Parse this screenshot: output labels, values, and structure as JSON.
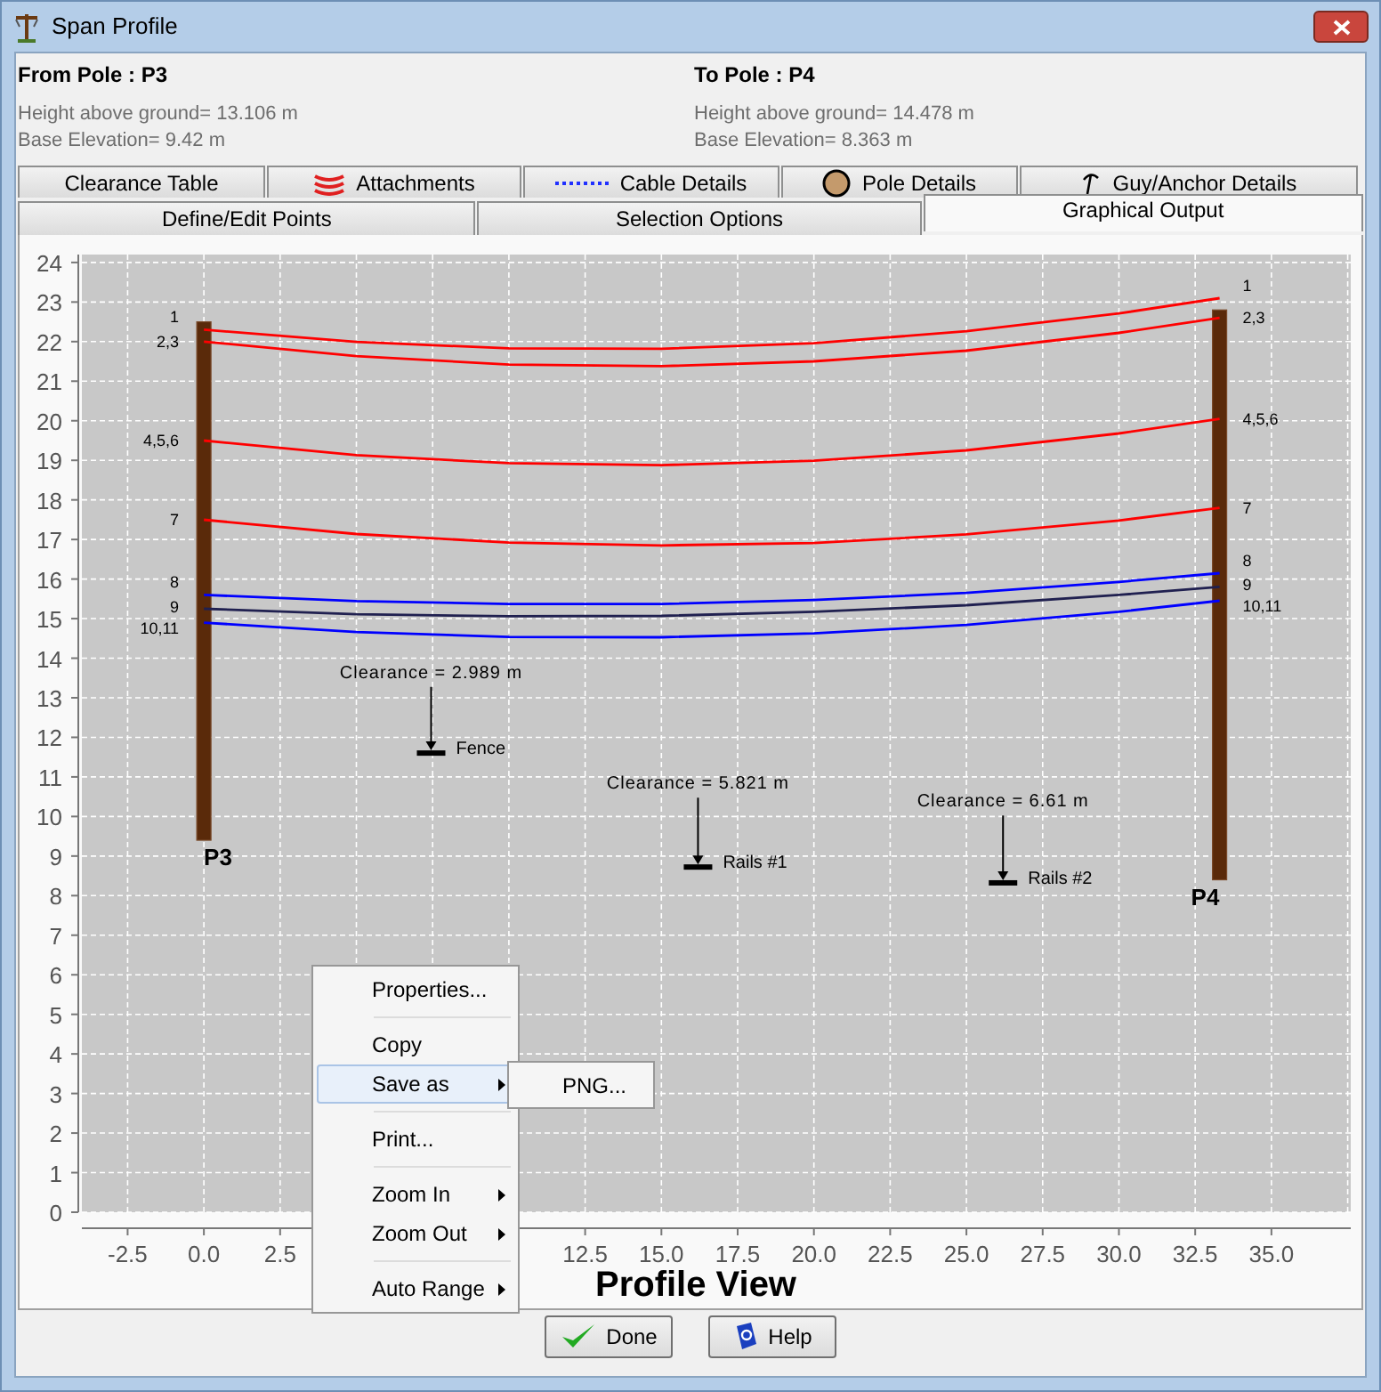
{
  "window": {
    "title": "Span Profile"
  },
  "header": {
    "from": {
      "title": "From Pole : P3",
      "height": "Height above ground= 13.106 m",
      "elevation": "Base Elevation= 9.42 m"
    },
    "to": {
      "title": "To Pole : P4",
      "height": "Height above ground= 14.478 m",
      "elevation": "Base Elevation= 8.363 m"
    }
  },
  "tabs_top": [
    {
      "label": "Clearance Table",
      "selected": false
    },
    {
      "label": "Attachments",
      "selected": false
    },
    {
      "label": "Cable Details",
      "selected": false
    },
    {
      "label": "Pole Details",
      "selected": false
    },
    {
      "label": "Guy/Anchor Details",
      "selected": false
    }
  ],
  "tabs_bottom": [
    {
      "label": "Define/Edit Points",
      "selected": false
    },
    {
      "label": "Selection Options",
      "selected": false
    },
    {
      "label": "Graphical Output",
      "selected": true
    }
  ],
  "graph": {
    "title": "Profile View",
    "poles": [
      {
        "label": "P3"
      },
      {
        "label": "P4"
      }
    ],
    "clearances": [
      {
        "text": "Clearance = 2.989 m",
        "label": "Fence"
      },
      {
        "text": "Clearance = 5.821 m",
        "label": "Rails #1"
      },
      {
        "text": "Clearance = 6.61 m",
        "label": "Rails #2"
      }
    ],
    "chart_data": {
      "type": "line",
      "grid": true,
      "x": [
        0,
        5,
        10,
        15,
        20,
        25,
        30,
        33.3
      ],
      "xlim": [
        -4,
        37.6
      ],
      "ylim": [
        0,
        24.2
      ],
      "xticks": [
        {
          "value": -2.5,
          "label": "-2.5"
        },
        {
          "value": 0,
          "label": "0.0"
        },
        {
          "value": 2.5,
          "label": "2.5"
        },
        {
          "value": 12.5,
          "label": "12.5"
        },
        {
          "value": 15,
          "label": "15.0"
        },
        {
          "value": 17.5,
          "label": "17.5"
        },
        {
          "value": 20,
          "label": "20.0"
        },
        {
          "value": 22.5,
          "label": "22.5"
        },
        {
          "value": 25,
          "label": "25.0"
        },
        {
          "value": 27.5,
          "label": "27.5"
        },
        {
          "value": 30,
          "label": "30.0"
        },
        {
          "value": 32.5,
          "label": "32.5"
        },
        {
          "value": 35,
          "label": "35.0"
        }
      ],
      "yticks": [
        0,
        1,
        2,
        3,
        4,
        5,
        6,
        7,
        8,
        9,
        10,
        11,
        12,
        13,
        14,
        15,
        16,
        17,
        18,
        19,
        20,
        21,
        22,
        23,
        24
      ],
      "series": [
        {
          "name": "1",
          "color": "#ff0000",
          "values": [
            22.3,
            21.99,
            21.83,
            21.82,
            21.96,
            22.26,
            22.71,
            23.1
          ]
        },
        {
          "name": "2,3",
          "color": "#ff0000",
          "values": [
            22.0,
            21.63,
            21.42,
            21.38,
            21.5,
            21.77,
            22.22,
            22.6
          ]
        },
        {
          "name": "4,5,6",
          "color": "#ff0000",
          "values": [
            19.5,
            19.13,
            18.93,
            18.88,
            18.99,
            19.25,
            19.68,
            20.05
          ]
        },
        {
          "name": "7",
          "color": "#ff0000",
          "values": [
            17.5,
            17.14,
            16.92,
            16.85,
            16.91,
            17.13,
            17.48,
            17.8
          ]
        },
        {
          "name": "8",
          "color": "#0000ff",
          "values": [
            15.6,
            15.44,
            15.37,
            15.37,
            15.47,
            15.65,
            15.93,
            16.15
          ]
        },
        {
          "name": "9",
          "color": "#202050",
          "values": [
            15.25,
            15.11,
            15.06,
            15.07,
            15.17,
            15.34,
            15.6,
            15.8
          ]
        },
        {
          "name": "10,11",
          "color": "#0000ff",
          "values": [
            14.9,
            14.66,
            14.54,
            14.53,
            14.63,
            14.84,
            15.17,
            15.45
          ]
        }
      ]
    }
  },
  "context_menu": {
    "items": [
      {
        "kind": "item",
        "label": "Properties...",
        "has_submenu": false,
        "selected": false
      },
      {
        "kind": "separator"
      },
      {
        "kind": "item",
        "label": "Copy",
        "has_submenu": false,
        "selected": false
      },
      {
        "kind": "item",
        "label": "Save as",
        "has_submenu": true,
        "selected": true
      },
      {
        "kind": "separator"
      },
      {
        "kind": "item",
        "label": "Print...",
        "has_submenu": false,
        "selected": false
      },
      {
        "kind": "separator"
      },
      {
        "kind": "item",
        "label": "Zoom In",
        "has_submenu": true,
        "selected": false
      },
      {
        "kind": "item",
        "label": "Zoom Out",
        "has_submenu": true,
        "selected": false
      },
      {
        "kind": "separator"
      },
      {
        "kind": "item",
        "label": "Auto Range",
        "has_submenu": true,
        "selected": false
      }
    ],
    "submenu": {
      "items": [
        {
          "label": "PNG..."
        }
      ]
    }
  },
  "buttons": [
    {
      "label": "Done"
    },
    {
      "label": "Help"
    }
  ]
}
